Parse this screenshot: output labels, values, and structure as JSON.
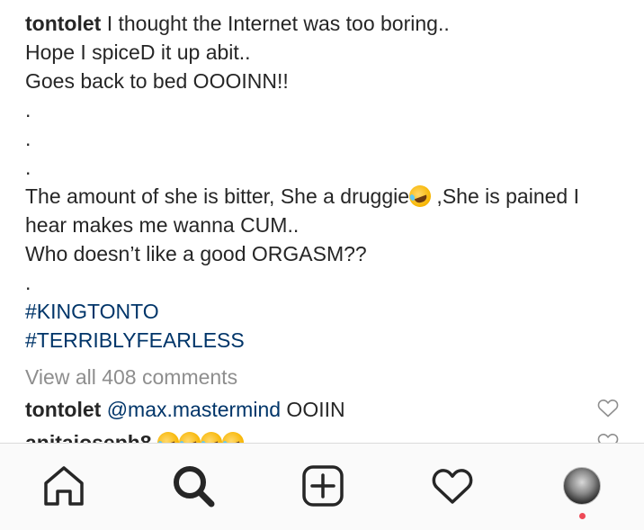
{
  "post": {
    "caption": {
      "username": "tontolet",
      "line1_text": "I thought the Internet was too boring..",
      "line2": "Hope I spiceD it up abit..",
      "line3": "Goes back to bed OOOINN!!",
      "dot1": ".",
      "dot2": ".",
      "dot3": ".",
      "paragraph_part1": "The amount of she is bitter, She a druggie",
      "paragraph_part2": " ,She is pained I hear makes me wanna CUM..",
      "line_orgasm": "Who doesn’t like a good ORGASM??",
      "dot4": ".",
      "hashtag1": "#KINGTONTO",
      "hashtag2": "#TERRIBLYFEARLESS"
    },
    "view_all_comments": "View all 408 comments",
    "comments": [
      {
        "username": "tontolet",
        "mention": "@max.mastermind",
        "text": " OOIIN"
      },
      {
        "username": "anitajoseph8",
        "text": ""
      }
    ]
  },
  "bottom_nav": {
    "items": [
      {
        "icon": "home-icon"
      },
      {
        "icon": "search-icon",
        "active": true
      },
      {
        "icon": "add-post-icon"
      },
      {
        "icon": "heart-icon"
      },
      {
        "icon": "profile-avatar"
      }
    ],
    "notification_dot_color": "#ed4956"
  },
  "colors": {
    "text": "#262626",
    "link": "#003569",
    "muted": "#8e8e8e",
    "nav_bg": "#fafafa"
  }
}
